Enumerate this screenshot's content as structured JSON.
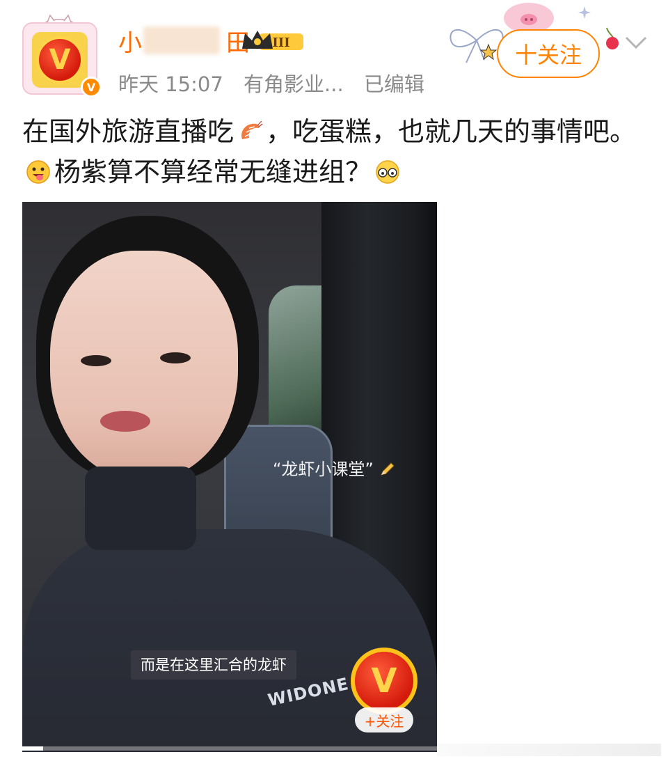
{
  "post": {
    "author": {
      "name_visible_prefix": "小",
      "name_visible_suffix": "田",
      "level_badge": "III"
    },
    "meta": {
      "time": "昨天 15:07",
      "source": "有角影业...",
      "edited": "已编辑"
    },
    "follow_label": "十关注",
    "text_part1": "在国外旅游直播吃",
    "text_part2": "，吃蛋糕，也就几天的事情吧。",
    "text_part3": "杨紫算不算经常无缝进组？",
    "emojis": [
      "shrimp-emoji",
      "tongue-emoji",
      "glasses-emoji"
    ]
  },
  "media": {
    "overlay_tag": "“龙虾小课堂”",
    "subtitle": "而是在这里汇合的龙虾",
    "shirt_logo": "WIDONE",
    "mini_follow_label": "+关注",
    "avatar_letter": "V",
    "progress": 0.05
  },
  "colors": {
    "accent": "#ff8200",
    "username": "#ff6a00",
    "meta": "#8a8a8a"
  }
}
